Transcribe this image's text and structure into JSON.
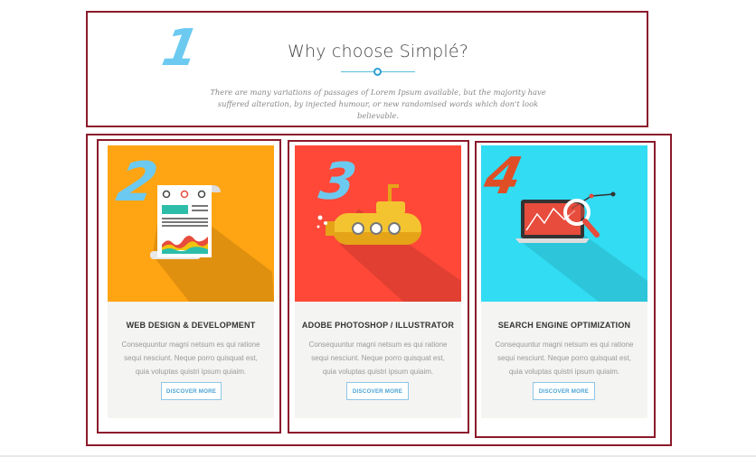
{
  "header": {
    "title": "Why choose Simplé?",
    "description": "There are many variations of passages of Lorem Ipsum available, but the majority have suffered alteration, by injected humour, or new randomised words which don't look believable."
  },
  "annotations": [
    "1",
    "2",
    "3",
    "4"
  ],
  "cards": [
    {
      "title": "WEB DESIGN & DEVELOPMENT",
      "text": "Consequuntur magni netsum es qui ratione sequi nesciunt. Neque porro quisquat est, quia voluptas quistri ipsum quiaim.",
      "button": "DISCOVER MORE",
      "bg_color": "#ffa412",
      "icon": "document-report-icon"
    },
    {
      "title": "ADOBE PHOTOSHOP / ILLUSTRATOR",
      "text": "Consequuntur magni netsum es qui ratione sequi nesciunt. Neque porro quisquat est, quia voluptas quistri ipsum quiaim.",
      "button": "DISCOVER MORE",
      "bg_color": "#ff4838",
      "icon": "submarine-icon"
    },
    {
      "title": "SEARCH ENGINE OPTIMIZATION",
      "text": "Consequuntur magni netsum es qui ratione sequi nesciunt. Neque porro quisquat est, quia voluptas quistri ipsum quiaim.",
      "button": "DISCOVER MORE",
      "bg_color": "#32dcf3",
      "icon": "laptop-magnifier-icon"
    }
  ],
  "colors": {
    "annotation_box": "#8b1a2b",
    "annotation_number_blue": "#6ccaf0",
    "annotation_number_red": "#e04e26",
    "accent": "#2a9fd6"
  }
}
